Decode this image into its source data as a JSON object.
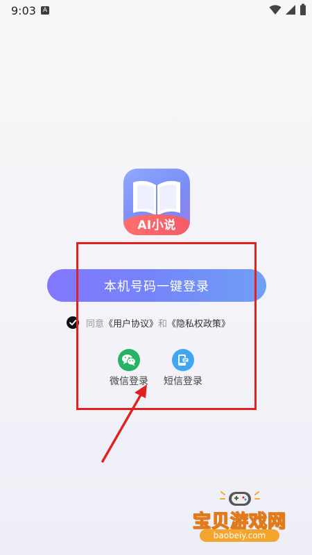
{
  "status_bar": {
    "time": "9:03",
    "notification_badge": "A",
    "icons": [
      "wifi-icon",
      "signal-icon",
      "battery-icon"
    ]
  },
  "app": {
    "logo_text": "AI小说"
  },
  "login": {
    "one_click_label": "本机号码一键登录",
    "agreement": {
      "checked": true,
      "prefix": "同意",
      "user_agreement": "《用户协议》",
      "connector": "和",
      "privacy_policy": "《隐私权政策》"
    },
    "options": [
      {
        "label": "微信登录",
        "icon": "wechat-icon"
      },
      {
        "label": "短信登录",
        "icon": "sms-icon"
      }
    ]
  },
  "watermark": {
    "text": "宝贝游戏网",
    "url": "baobeiy.com"
  },
  "colors": {
    "button_start": "#8377ff",
    "button_end": "#6fa0f6",
    "wechat": "#27b364",
    "sms": "#3fa6ef",
    "annotation_red": "#e1211f"
  }
}
